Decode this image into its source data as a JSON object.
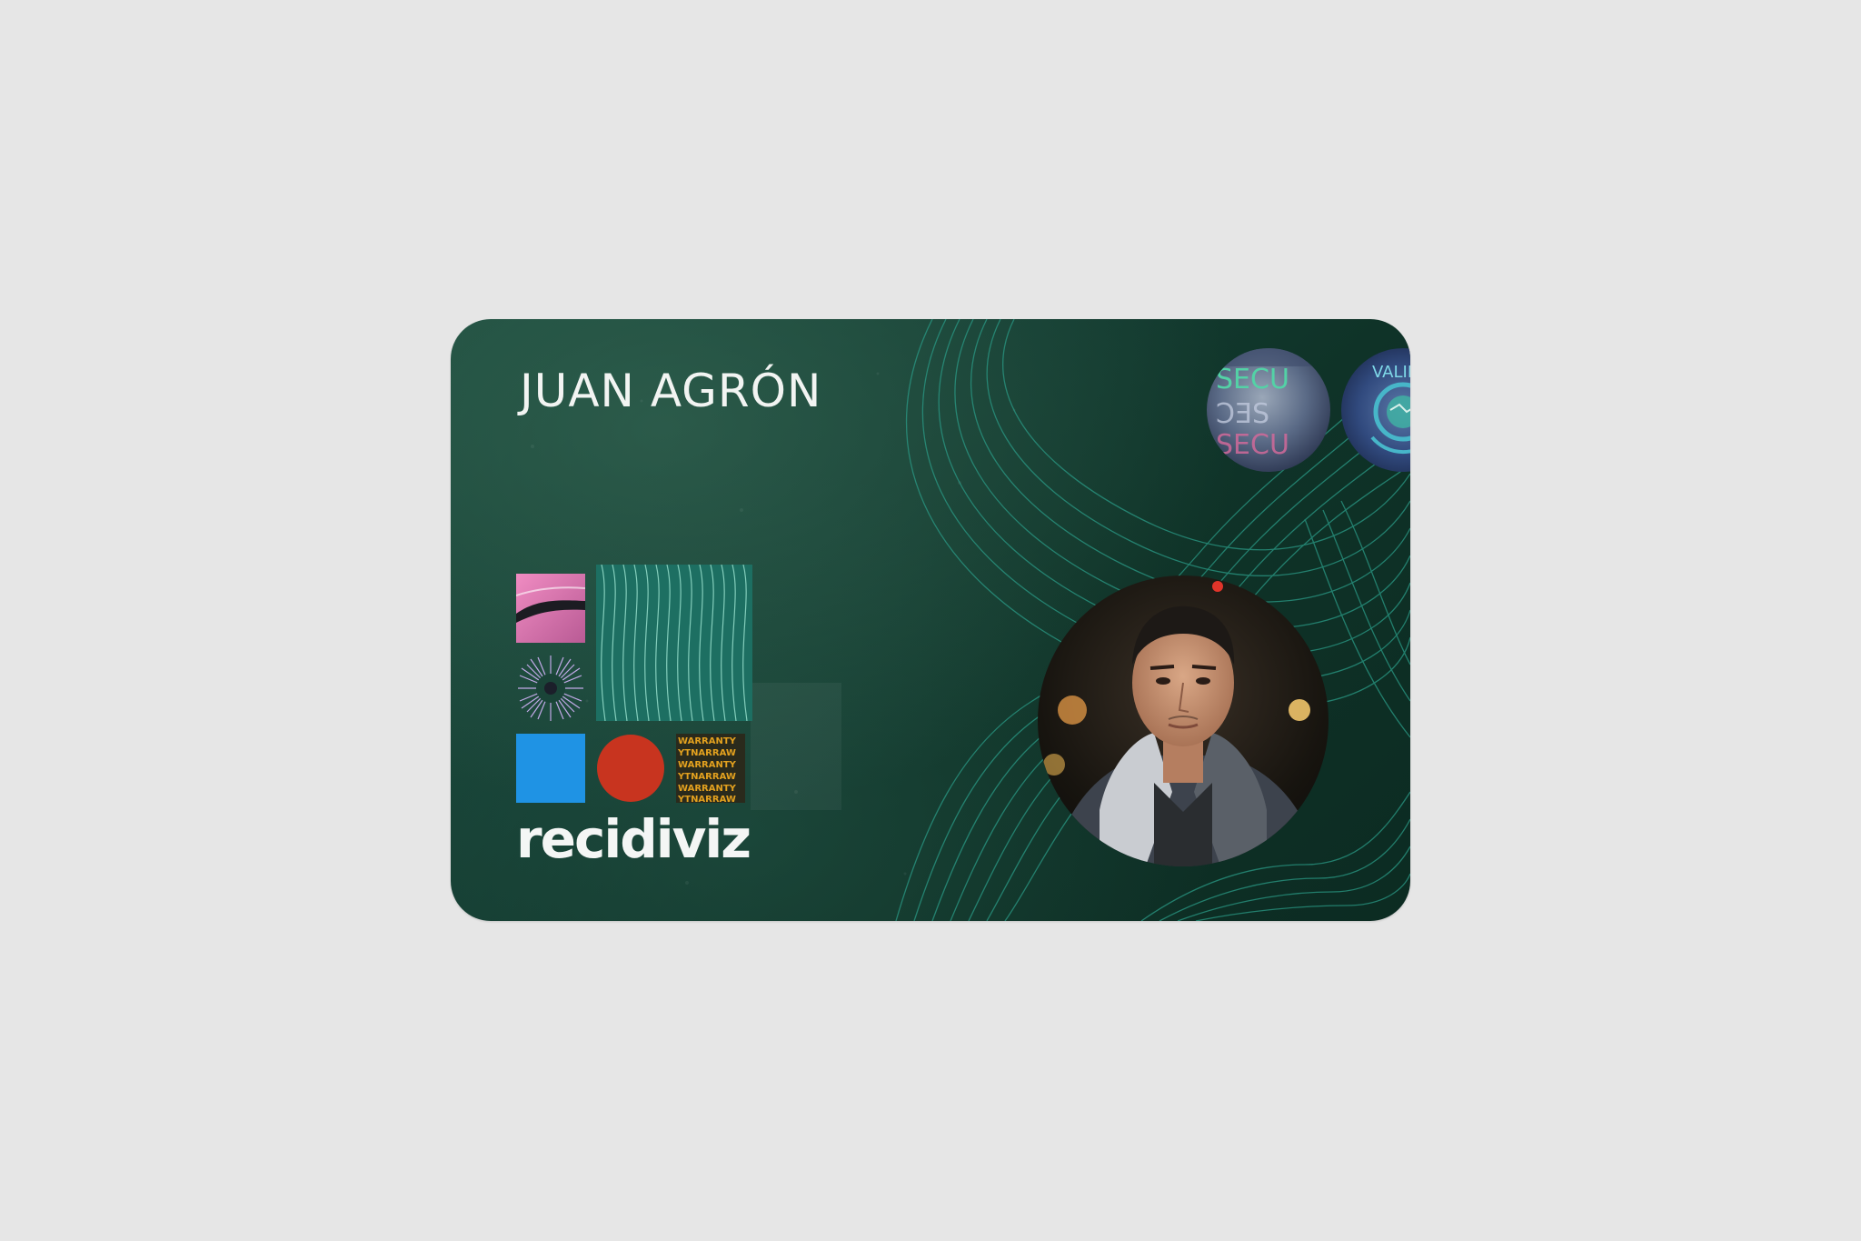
{
  "card": {
    "holder_name": "JUAN AGRÓN",
    "brand_name": "recidiviz"
  },
  "hologram_left": {
    "text": "SECU"
  },
  "hologram_right": {
    "text": "VALID"
  },
  "warranty_tile": {
    "text": "WARRANTY"
  },
  "colors": {
    "card_background": "#143d32",
    "contour_lines": "#2a9a86",
    "tile_pink": "#e07ab3",
    "tile_teal": "#1d6f62",
    "tile_burst": "#b39be0",
    "tile_blue": "#1f93e4",
    "tile_red": "#c8341f",
    "tile_warranty": "#e3a11f",
    "page_background": "#e6e6e6"
  },
  "icons": {
    "photo": "person-portrait-icon",
    "hologram_left": "security-hologram-icon",
    "hologram_right": "globe-hologram-icon"
  }
}
